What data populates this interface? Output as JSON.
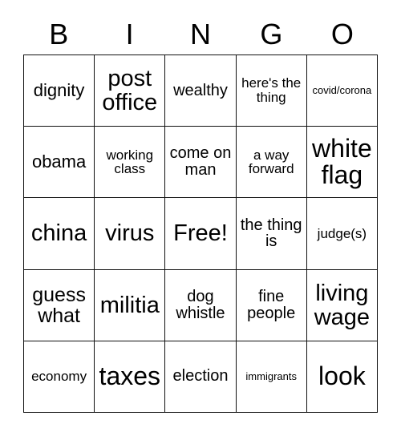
{
  "header": {
    "letters": [
      "B",
      "I",
      "N",
      "G",
      "O"
    ]
  },
  "grid": {
    "rows": 5,
    "columns": 5,
    "border_color": "#111111",
    "background_color": "#ffffff",
    "text_color": "#000000",
    "cells": [
      {
        "text": "dignity",
        "size": "lg"
      },
      {
        "text": "post office",
        "size": "xxl"
      },
      {
        "text": "wealthy",
        "size": "md"
      },
      {
        "text": "here's the thing",
        "size": "sm"
      },
      {
        "text": "covid/corona",
        "size": "xs"
      },
      {
        "text": "obama",
        "size": "lg"
      },
      {
        "text": "working class",
        "size": "sm"
      },
      {
        "text": "come on man",
        "size": "md"
      },
      {
        "text": "a way forward",
        "size": "sm"
      },
      {
        "text": "white flag",
        "size": "xxxl"
      },
      {
        "text": "china",
        "size": "xxl"
      },
      {
        "text": "virus",
        "size": "xxl"
      },
      {
        "text": "Free!",
        "size": "xxl"
      },
      {
        "text": "the thing is",
        "size": "md"
      },
      {
        "text": "judge(s)",
        "size": "sm"
      },
      {
        "text": "guess what",
        "size": "xl"
      },
      {
        "text": "militia",
        "size": "xxl"
      },
      {
        "text": "dog whistle",
        "size": "md"
      },
      {
        "text": "fine people",
        "size": "md"
      },
      {
        "text": "living wage",
        "size": "xxl"
      },
      {
        "text": "economy",
        "size": "sm"
      },
      {
        "text": "taxes",
        "size": "xxxl"
      },
      {
        "text": "election",
        "size": "md"
      },
      {
        "text": "immigrants",
        "size": "xs"
      },
      {
        "text": "look",
        "size": "xxxl"
      }
    ]
  }
}
